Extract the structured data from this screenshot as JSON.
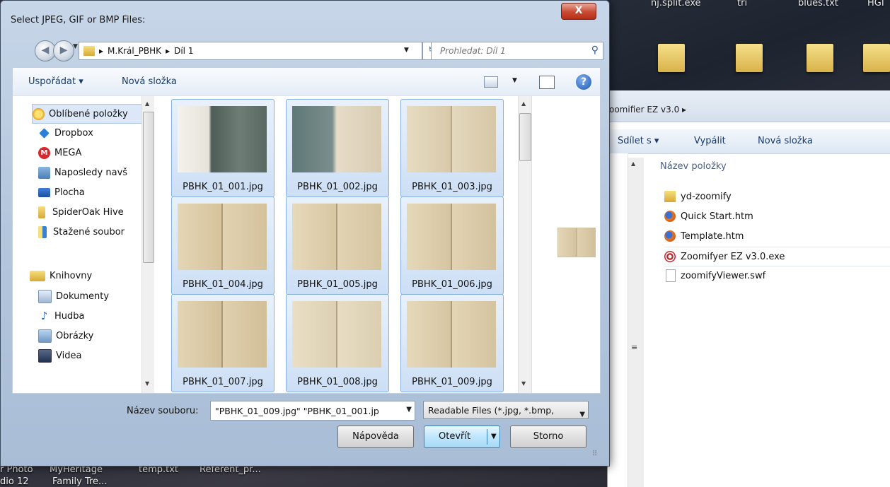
{
  "desktop": {
    "top_labels": [
      "nj.split.exe",
      "tri",
      "blues.txt",
      "HGI"
    ],
    "bottom_labels_row1": [
      "r Photo",
      "MyHeritage",
      "temp.txt",
      "Referent_pr..."
    ],
    "bottom_labels_row2": [
      "dio 12",
      "Family Tre..."
    ]
  },
  "explorer": {
    "address_crumb": "oomifier EZ v3.0 ▸",
    "toolbar": {
      "share": "Sdílet s ▾",
      "burn": "Vypálit",
      "new_folder": "Nová složka"
    },
    "column_header": "Název položky",
    "items": [
      {
        "name": "yd-zoomify",
        "icon": "folder-icon"
      },
      {
        "name": "Quick Start.htm",
        "icon": "firefox-icon"
      },
      {
        "name": "Template.htm",
        "icon": "firefox-icon"
      },
      {
        "name": "Zoomifyer EZ v3.0.exe",
        "icon": "zoomifyer-icon"
      },
      {
        "name": "zoomifyViewer.swf",
        "icon": "file-icon"
      }
    ]
  },
  "dialog": {
    "title": "Select JPEG, GIF or BMP Files:",
    "close_label": "X",
    "breadcrumb": [
      "M.Král_PBHK",
      "Díl 1"
    ],
    "breadcrumb_sep": "▸",
    "search_placeholder": "Prohledat: Díl 1",
    "toolbar": {
      "organize": "Uspořádat ▾",
      "new_folder": "Nová složka"
    },
    "help_label": "?",
    "nav": {
      "favorites_header": "Oblíbené položky",
      "favorites": [
        "Dropbox",
        "MEGA",
        "Naposledy navš",
        "Plocha",
        "SpiderOak Hive",
        "Stažené soubor"
      ],
      "libraries_header": "Knihovny",
      "libraries": [
        "Dokumenty",
        "Hudba",
        "Obrázky",
        "Videa"
      ]
    },
    "files": [
      "PBHK_01_001.jpg",
      "PBHK_01_002.jpg",
      "PBHK_01_003.jpg",
      "PBHK_01_004.jpg",
      "PBHK_01_005.jpg",
      "PBHK_01_006.jpg",
      "PBHK_01_007.jpg",
      "PBHK_01_008.jpg",
      "PBHK_01_009.jpg"
    ],
    "filename_label": "Název souboru:",
    "filename_value": "\"PBHK_01_009.jpg\" \"PBHK_01_001.jp",
    "filetype_value": "Readable Files (*.jpg, *.bmp,",
    "buttons": {
      "help": "Nápověda",
      "open": "Otevřít",
      "cancel": "Storno"
    }
  },
  "colors": {
    "selection": "#cddff5",
    "selection_border": "#86b1e3",
    "close": "#c84a32"
  }
}
